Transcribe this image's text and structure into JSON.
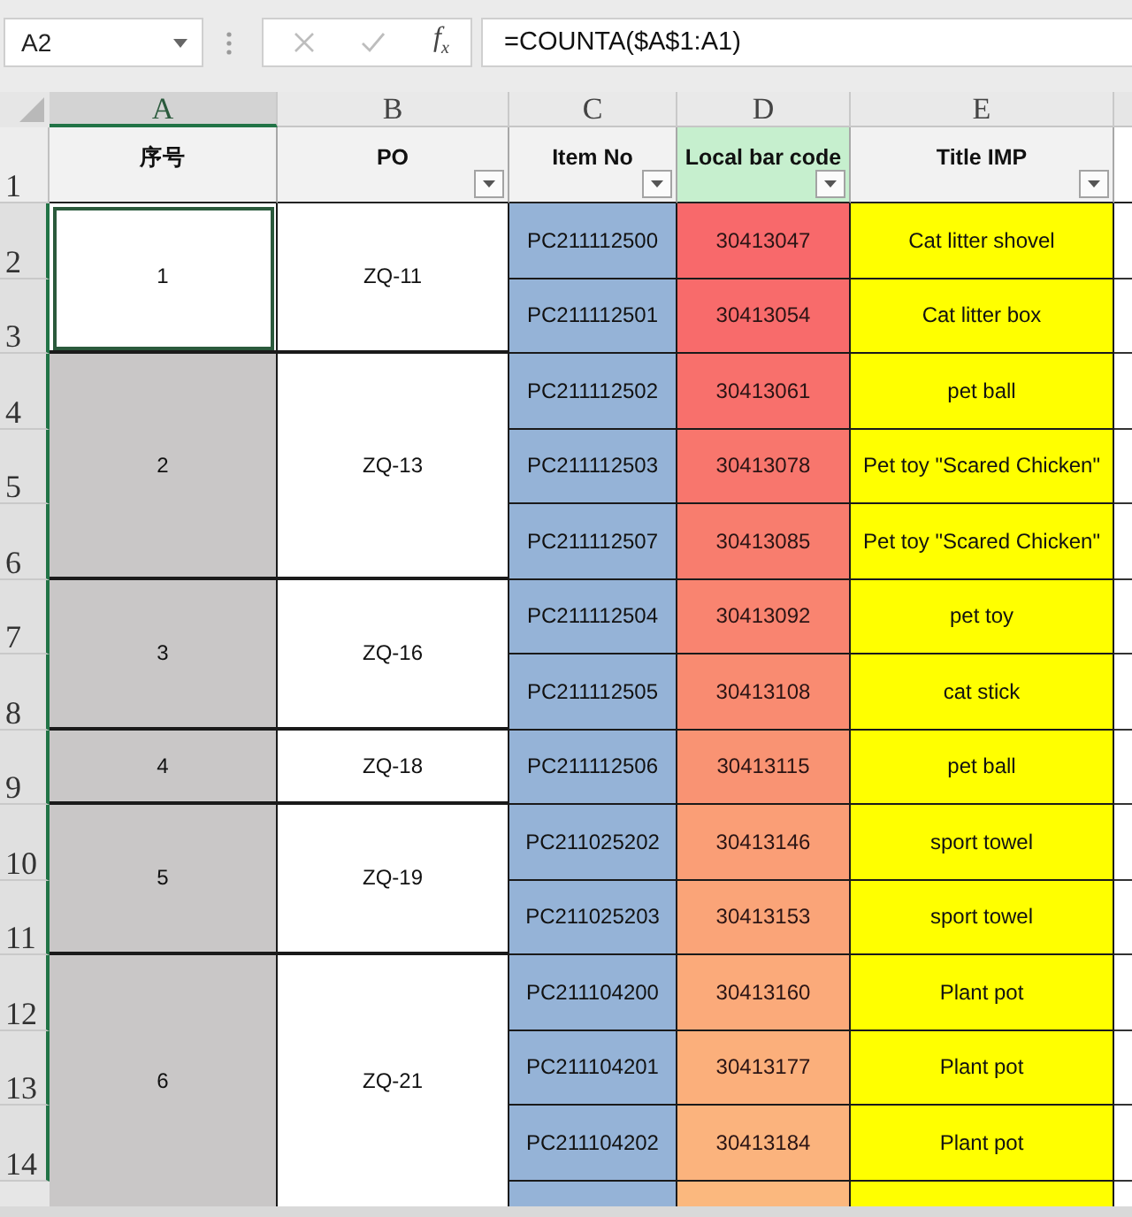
{
  "formula_bar": {
    "name_box": "A2",
    "cancel": {
      "disabled": true
    },
    "enter": {
      "disabled": true
    },
    "function_label": "f$_{x}$",
    "formula": "=COUNTA($A$1:A1)"
  },
  "columns": [
    {
      "letter": "A",
      "selected": true
    },
    {
      "letter": "B",
      "selected": false
    },
    {
      "letter": "C",
      "selected": false
    },
    {
      "letter": "D",
      "selected": false
    },
    {
      "letter": "E",
      "selected": false
    }
  ],
  "row_numbers": [
    {
      "label": "1",
      "selected": false
    },
    {
      "label": "2",
      "selected": true
    },
    {
      "label": "3",
      "selected": true
    },
    {
      "label": "4",
      "selected": true
    },
    {
      "label": "5",
      "selected": true
    },
    {
      "label": "6",
      "selected": true
    },
    {
      "label": "7",
      "selected": true
    },
    {
      "label": "8",
      "selected": true
    },
    {
      "label": "9",
      "selected": true
    },
    {
      "label": "10",
      "selected": true
    },
    {
      "label": "11",
      "selected": true
    },
    {
      "label": "12",
      "selected": true
    },
    {
      "label": "13",
      "selected": true
    },
    {
      "label": "14",
      "selected": true
    }
  ],
  "headers": [
    {
      "text": "序号",
      "color": "#f2f2f2",
      "filter": false
    },
    {
      "text": "PO",
      "color": "#f2f2f2",
      "filter": true
    },
    {
      "text": "Item No",
      "color": "#f2f2f2",
      "filter": true
    },
    {
      "text": "Local bar code",
      "color": "#c6efce",
      "filter": true
    },
    {
      "text": "Title IMP",
      "color": "#f2f2f2",
      "filter": true
    }
  ],
  "groups": [
    {
      "seq": {
        "text": "1",
        "selected": true,
        "active": true
      },
      "po": "ZQ-11",
      "rows": [
        {
          "item_no": "PC211112500",
          "bar_code": "30413047",
          "color": "#f8696b",
          "title": "Cat litter shovel"
        },
        {
          "item_no": "PC211112501",
          "bar_code": "30413054",
          "color": "#f86b6b",
          "title": "Cat litter box"
        }
      ]
    },
    {
      "seq": {
        "text": "2",
        "selected": true,
        "active": false
      },
      "po": "ZQ-13",
      "rows": [
        {
          "item_no": "PC211112502",
          "bar_code": "30413061",
          "color": "#f8706c",
          "title": "pet ball"
        },
        {
          "item_no": "PC211112503",
          "bar_code": "30413078",
          "color": "#f8766d",
          "title": "Pet toy \"Scared Chicken\""
        },
        {
          "item_no": "PC211112507",
          "bar_code": "30413085",
          "color": "#f87d6e",
          "title": "Pet toy \"Scared Chicken\""
        }
      ]
    },
    {
      "seq": {
        "text": "3",
        "selected": true,
        "active": false
      },
      "po": "ZQ-16",
      "rows": [
        {
          "item_no": "PC211112504",
          "bar_code": "30413092",
          "color": "#f98470",
          "title": "pet toy"
        },
        {
          "item_no": "PC211112505",
          "bar_code": "30413108",
          "color": "#f98b71",
          "title": "cat stick"
        }
      ]
    },
    {
      "seq": {
        "text": "4",
        "selected": true,
        "active": false
      },
      "po": "ZQ-18",
      "rows": [
        {
          "item_no": "PC211112506",
          "bar_code": "30413115",
          "color": "#f99373",
          "title": "pet ball"
        }
      ]
    },
    {
      "seq": {
        "text": "5",
        "selected": true,
        "active": false
      },
      "po": "ZQ-19",
      "rows": [
        {
          "item_no": "PC211025202",
          "bar_code": "30413146",
          "color": "#fa9e76",
          "title": "sport towel"
        },
        {
          "item_no": "PC211025203",
          "bar_code": "30413153",
          "color": "#faa478",
          "title": "sport towel"
        }
      ]
    },
    {
      "seq": {
        "text": "6",
        "selected": true,
        "active": false
      },
      "po": "ZQ-21",
      "rows": [
        {
          "item_no": "PC211104200",
          "bar_code": "30413160",
          "color": "#fbaa7a",
          "title": "Plant pot"
        },
        {
          "item_no": "PC211104201",
          "bar_code": "30413177",
          "color": "#fbaf7b",
          "title": "Plant pot"
        },
        {
          "item_no": "PC211104202",
          "bar_code": "30413184",
          "color": "#fbb37d",
          "title": "Plant pot"
        },
        {
          "color": "#fbb87e"
        }
      ]
    }
  ]
}
